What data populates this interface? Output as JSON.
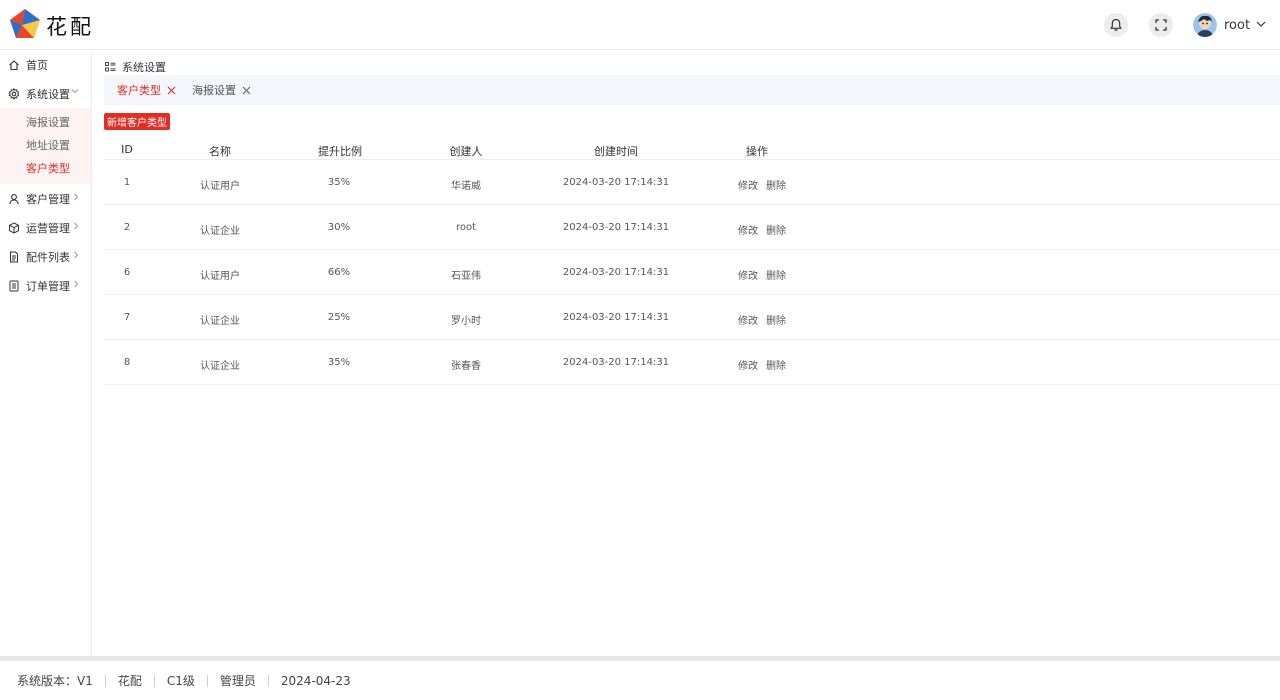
{
  "app": {
    "brand": "花配"
  },
  "header": {
    "user_name": "root"
  },
  "sidebar": {
    "items": [
      {
        "label": "首页",
        "icon": "home-icon"
      },
      {
        "label": "系统设置",
        "icon": "gear-icon",
        "expanded": true,
        "children": [
          {
            "label": "海报设置",
            "active": false
          },
          {
            "label": "地址设置",
            "active": false
          },
          {
            "label": "客户类型",
            "active": true
          }
        ]
      },
      {
        "label": "客户管理",
        "icon": "user-icon"
      },
      {
        "label": "运营管理",
        "icon": "cube-icon"
      },
      {
        "label": "配件列表",
        "icon": "document-icon"
      },
      {
        "label": "订单管理",
        "icon": "list-icon"
      }
    ]
  },
  "breadcrumb": {
    "label": "系统设置"
  },
  "tabs": [
    {
      "label": "客户类型",
      "active": true
    },
    {
      "label": "海报设置",
      "active": false
    }
  ],
  "toolbar": {
    "add_label": "新增客户类型"
  },
  "table": {
    "columns": [
      "ID",
      "名称",
      "提升比例",
      "创建人",
      "创建时间",
      "操作"
    ],
    "rows": [
      {
        "id": "1",
        "name": "认证用户",
        "ratio": "35%",
        "creator": "华诺威",
        "created": "2024-03-20 17:14:31"
      },
      {
        "id": "2",
        "name": "认证企业",
        "ratio": "30%",
        "creator": "root",
        "created": "2024-03-20 17:14:31"
      },
      {
        "id": "6",
        "name": "认证用户",
        "ratio": "66%",
        "creator": "石亚伟",
        "created": "2024-03-20 17:14:31"
      },
      {
        "id": "7",
        "name": "认证企业",
        "ratio": "25%",
        "creator": "罗小时",
        "created": "2024-03-20 17:14:31"
      },
      {
        "id": "8",
        "name": "认证企业",
        "ratio": "35%",
        "creator": "张春香",
        "created": "2024-03-20 17:14:31"
      }
    ],
    "actions": {
      "edit": "修改",
      "delete": "删除"
    }
  },
  "footer": {
    "version": "系统版本：V1",
    "app_name": "花配",
    "level": "C1级",
    "role": "管理员",
    "date": "2024-04-23"
  },
  "colors": {
    "accent": "#e02e24",
    "tab_bg": "#f3f6fa",
    "submenu_bg": "#fdf3f3"
  }
}
